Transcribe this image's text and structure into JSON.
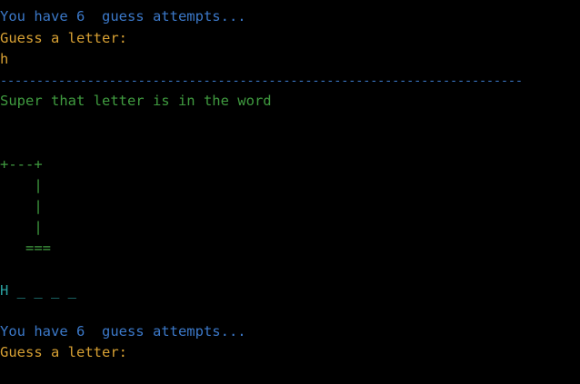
{
  "terminal": {
    "lines": [
      "You have 6  guess attempts...",
      "Guess a letter:",
      "h",
      "------------------------------------------------------------------------",
      "Super that letter is in the word",
      "+---+",
      "    |",
      "    |",
      "    |",
      "   ===",
      "H _ _ _ _",
      "You have 6  guess attempts...",
      "Guess a letter:"
    ],
    "colors": {
      "prompt_info": "#3b78c8",
      "prompt_input": "#d7a033",
      "success": "#3f9a3f",
      "word": "#2aa0a0",
      "user_input": "#e8e8e8"
    },
    "cursor_icon": "block-cursor-icon"
  }
}
